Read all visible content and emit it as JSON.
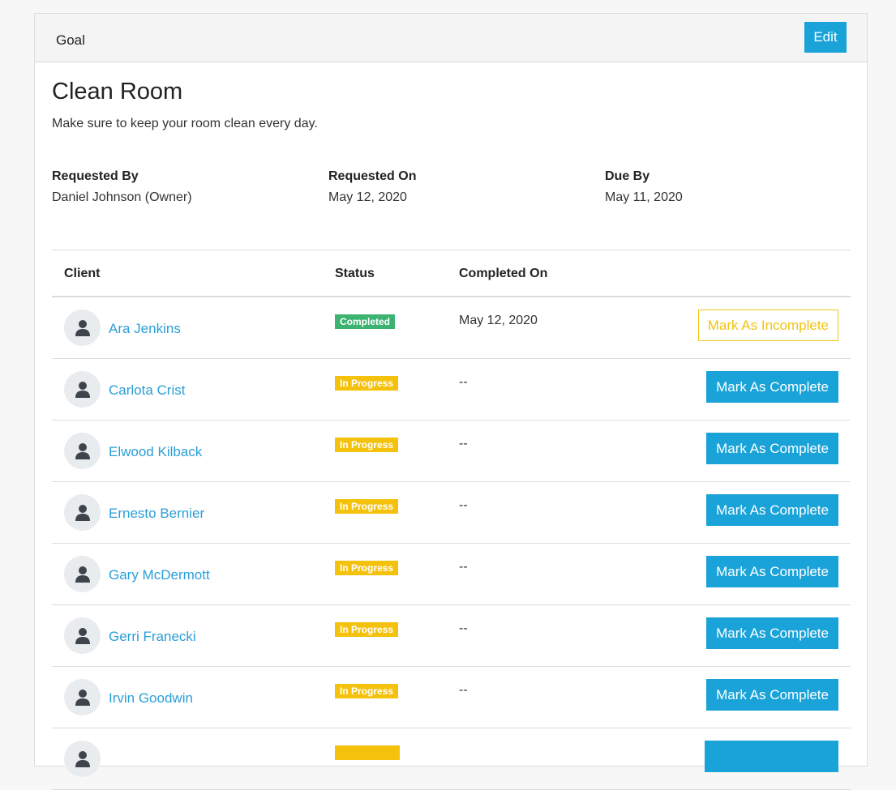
{
  "header": {
    "title": "Goal",
    "edit_label": "Edit"
  },
  "goal": {
    "title": "Clean Room",
    "description": "Make sure to keep your room clean every day."
  },
  "meta": {
    "requested_by_label": "Requested By",
    "requested_by_value": "Daniel Johnson (Owner)",
    "requested_on_label": "Requested On",
    "requested_on_value": "May 12, 2020",
    "due_by_label": "Due By",
    "due_by_value": "May 11, 2020"
  },
  "table": {
    "columns": [
      "Client",
      "Status",
      "Completed On"
    ],
    "rows": [
      {
        "client": "Ara Jenkins",
        "status": "Completed",
        "status_type": "completed",
        "completed_on": "May 12, 2020",
        "action": "Mark As Incomplete",
        "action_type": "incomplete"
      },
      {
        "client": "Carlota Crist",
        "status": "In Progress",
        "status_type": "progress",
        "completed_on": "--",
        "action": "Mark As Complete",
        "action_type": "complete"
      },
      {
        "client": "Elwood Kilback",
        "status": "In Progress",
        "status_type": "progress",
        "completed_on": "--",
        "action": "Mark As Complete",
        "action_type": "complete"
      },
      {
        "client": "Ernesto Bernier",
        "status": "In Progress",
        "status_type": "progress",
        "completed_on": "--",
        "action": "Mark As Complete",
        "action_type": "complete"
      },
      {
        "client": "Gary McDermott",
        "status": "In Progress",
        "status_type": "progress",
        "completed_on": "--",
        "action": "Mark As Complete",
        "action_type": "complete"
      },
      {
        "client": "Gerri Franecki",
        "status": "In Progress",
        "status_type": "progress",
        "completed_on": "--",
        "action": "Mark As Complete",
        "action_type": "complete"
      },
      {
        "client": "Irvin Goodwin",
        "status": "In Progress",
        "status_type": "progress",
        "completed_on": "--",
        "action": "Mark As Complete",
        "action_type": "complete"
      },
      {
        "client": "",
        "status": "",
        "status_type": "progress",
        "completed_on": "",
        "action": "",
        "action_type": "complete"
      }
    ]
  },
  "colors": {
    "accent": "#1aa3d9",
    "link": "#2a9fd6",
    "completed_badge": "#3cb371",
    "progress_badge": "#f4c20d",
    "incomplete_outline": "#f1c40f"
  }
}
